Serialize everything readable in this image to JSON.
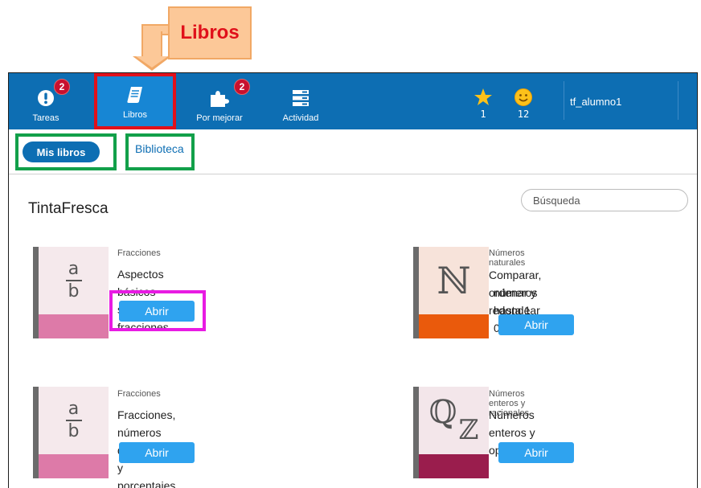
{
  "annotation": {
    "callout_label": "Libros"
  },
  "topbar": {
    "nav": [
      {
        "label": "Tareas",
        "icon": "alert-icon",
        "badge": "2"
      },
      {
        "label": "Libros",
        "icon": "book-icon",
        "badge": ""
      },
      {
        "label": "Por mejorar",
        "icon": "puzzle-icon",
        "badge": "2"
      },
      {
        "label": "Actividad",
        "icon": "list-icon",
        "badge": ""
      }
    ],
    "stars": "1",
    "smileys": "12",
    "username": "tf_alumno1"
  },
  "subnav": {
    "mis_libros": "Mis libros",
    "biblioteca": "Biblioteca"
  },
  "main": {
    "heading": "TintaFresca",
    "search_placeholder": "Búsqueda",
    "books": [
      {
        "category": "Fracciones",
        "title": "Aspectos básicos sobre fracciones",
        "button": "Abrir",
        "band_color": "#dd7aa8",
        "cover_color": "#f5e9ec"
      },
      {
        "category": "Números naturales",
        "title_line1": "Comparar, ordenar y redondear",
        "title_line2": "números hasta 1 000 000",
        "button": "Abrir",
        "band_color": "#ea5a0c",
        "cover_color": "#f7e3da",
        "symbol": "ℕ"
      },
      {
        "category": "Fracciones",
        "title": "Fracciones, números decimales y porcentajes",
        "button": "Abrir",
        "band_color": "#dd7aa8",
        "cover_color": "#f5e9ec"
      },
      {
        "category": "Números enteros y racionales",
        "title": "Números enteros y operaciones",
        "button": "Abrir",
        "band_color": "#9a1d4d",
        "cover_color": "#f3e6ea",
        "symbol_q": "ℚ",
        "symbol_z": "ℤ"
      }
    ],
    "fraction": {
      "num": "a",
      "den": "b"
    }
  },
  "colors": {
    "topbar": "#0d6eb3",
    "highlight_red": "#e1101a",
    "highlight_green": "#12a04a",
    "highlight_magenta": "#e81be3",
    "button": "#2fa3ef"
  }
}
